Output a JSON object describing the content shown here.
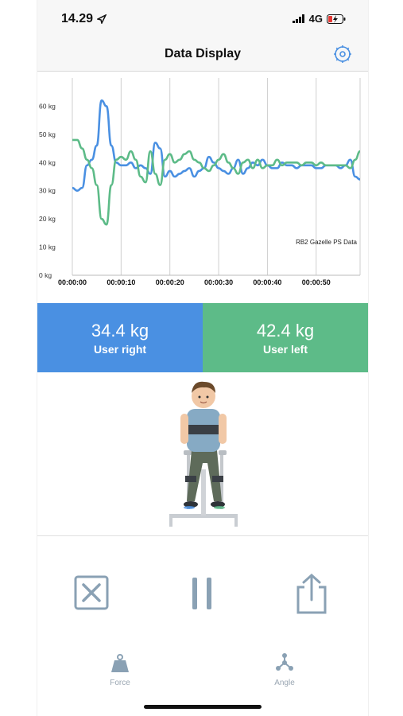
{
  "status_bar": {
    "time": "14.29",
    "network": "4G"
  },
  "header": {
    "title": "Data Display"
  },
  "colors": {
    "right": "#4a90e2",
    "left": "#5dbb88",
    "icon": "#8aa1b4"
  },
  "chart_data": {
    "type": "line",
    "ylim": [
      0,
      70
    ],
    "xlim": [
      0,
      59
    ],
    "y_ticks": [
      "0 kg",
      "10 kg",
      "20 kg",
      "30 kg",
      "40 kg",
      "50 kg",
      "60 kg"
    ],
    "x_ticks": [
      "00:00:00",
      "00:00:10",
      "00:00:20",
      "00:00:30",
      "00:00:40",
      "00:00:50"
    ],
    "annotation": "RB2 Gazelle PS Data",
    "series": [
      {
        "color": "#4a90e2",
        "x": [
          0,
          1,
          2,
          3,
          4,
          5,
          6,
          7,
          8,
          9,
          10,
          11,
          12,
          13,
          14,
          15,
          16,
          17,
          18,
          19,
          20,
          21,
          22,
          23,
          24,
          25,
          26,
          27,
          28,
          29,
          30,
          31,
          32,
          33,
          34,
          35,
          36,
          37,
          38,
          39,
          40,
          41,
          42,
          43,
          44,
          45,
          46,
          47,
          48,
          49,
          50,
          51,
          52,
          53,
          54,
          55,
          56,
          57,
          58,
          59
        ],
        "values": [
          31,
          30,
          31,
          39,
          41,
          46,
          62,
          60,
          46,
          40,
          39,
          39,
          40,
          38,
          39,
          38,
          36,
          47,
          45,
          35,
          37,
          35,
          36,
          37,
          38,
          35,
          37,
          38,
          42,
          40,
          38,
          37,
          36,
          38,
          41,
          36,
          38,
          40,
          39,
          41,
          39,
          38,
          38,
          40,
          39,
          39,
          38,
          39,
          39,
          39,
          38,
          38,
          39,
          39,
          39,
          38,
          39,
          41,
          35,
          34
        ]
      },
      {
        "color": "#5dbb88",
        "x": [
          0,
          1,
          2,
          3,
          4,
          5,
          6,
          7,
          8,
          9,
          10,
          11,
          12,
          13,
          14,
          15,
          16,
          17,
          18,
          19,
          20,
          21,
          22,
          23,
          24,
          25,
          26,
          27,
          28,
          29,
          30,
          31,
          32,
          33,
          34,
          35,
          36,
          37,
          38,
          39,
          40,
          41,
          42,
          43,
          44,
          45,
          46,
          47,
          48,
          49,
          50,
          51,
          52,
          53,
          54,
          55,
          56,
          57,
          58,
          59
        ],
        "values": [
          48,
          48,
          45,
          41,
          38,
          32,
          20,
          18,
          32,
          41,
          42,
          41,
          44,
          41,
          35,
          33,
          44,
          36,
          32,
          41,
          43,
          40,
          41,
          43,
          44,
          41,
          40,
          38,
          37,
          39,
          41,
          43,
          40,
          38,
          36,
          40,
          41,
          38,
          41,
          38,
          39,
          39,
          41,
          39,
          40,
          40,
          40,
          39,
          40,
          40,
          39,
          40,
          39,
          39,
          39,
          39,
          39,
          38,
          41,
          44
        ]
      }
    ]
  },
  "readouts": {
    "right": {
      "value": "34.4 kg",
      "label": "User right"
    },
    "left": {
      "value": "42.4 kg",
      "label": "User left"
    }
  },
  "tabs": {
    "force": "Force",
    "angle": "Angle"
  },
  "icons": {
    "gear": "gear-icon",
    "cancel": "cancel-icon",
    "pause": "pause-icon",
    "share": "share-icon",
    "force": "weight-icon",
    "angle": "angle-icon"
  }
}
